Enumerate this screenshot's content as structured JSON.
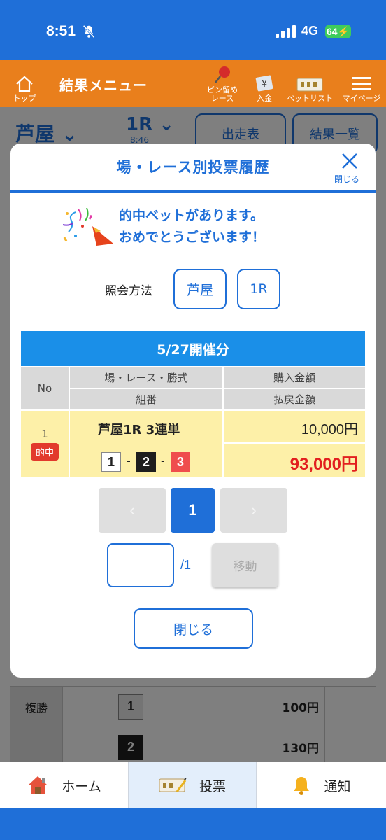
{
  "status_bar": {
    "time": "8:51",
    "network": "4G",
    "battery": "64"
  },
  "app_header": {
    "top_label": "トップ",
    "menu_title": "結果メニュー",
    "pin_label": "ピン留め\nレース",
    "deposit_label": "入金",
    "betlist_label": "ベットリスト",
    "mypage_label": "マイページ"
  },
  "background": {
    "venue": "芦屋",
    "race": "1R",
    "race_time": "8:46",
    "entries_btn": "出走表",
    "results_btn": "結果一覧",
    "rows": [
      {
        "type": "複勝",
        "num": "1",
        "payout": "100円"
      },
      {
        "type": "",
        "num": "2",
        "payout": "130円"
      }
    ]
  },
  "modal": {
    "title": "場・レース別投票履歴",
    "close_label": "閉じる",
    "congrats_line1": "的中ベットがあります。",
    "congrats_line2": "おめでとうございます！",
    "query_label": "照会方法",
    "query_venue": "芦屋",
    "query_race": "1R",
    "date_header": "5/27開催分",
    "table": {
      "col_no": "No",
      "col_race": "場・レース・勝式",
      "col_combo": "組番",
      "col_purchase": "購入金額",
      "col_payout": "払戻金額",
      "rows": [
        {
          "no": "1",
          "status": "的中",
          "race_link": "芦屋1R",
          "bet_type": "3連単",
          "combo": [
            "1",
            "2",
            "3"
          ],
          "purchase": "10,000円",
          "payout": "93,000円"
        }
      ]
    },
    "pagination": {
      "prev": "‹",
      "current": "1",
      "next": "›",
      "total": "/1",
      "move_label": "移動",
      "input_value": ""
    },
    "close_button": "閉じる"
  },
  "bottom_nav": {
    "home": "ホーム",
    "vote": "投票",
    "notify": "通知"
  },
  "colors": {
    "primary": "#1f6fd8",
    "header_orange": "#e97f1c",
    "hit_red": "#e23a2c",
    "highlight_yellow": "#fdf0a8"
  }
}
